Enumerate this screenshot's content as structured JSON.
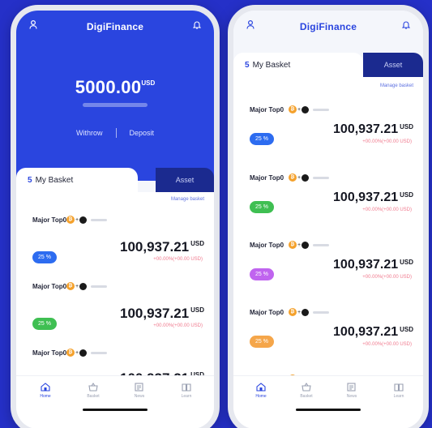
{
  "app": {
    "brand": "DigiFinance"
  },
  "balance": {
    "amount": "5000.00",
    "currency": "USD"
  },
  "hero_actions": {
    "withdraw": "Withrow",
    "deposit": "Deposit"
  },
  "tabs": {
    "basket_count": "5",
    "basket_label": "My Basket",
    "asset_label": "Asset"
  },
  "manage": {
    "phone1": "Manage basket",
    "phone2": "Manage basket"
  },
  "basket_items": [
    {
      "name": "Major Top0",
      "percent": "25 %",
      "price": "100,937.21",
      "currency": "USD",
      "change": "+00.00%(+00.00 USD)",
      "pill_color": "#2d6cf0"
    },
    {
      "name": "Major Top0",
      "percent": "25 %",
      "price": "100,937.21",
      "currency": "USD",
      "change": "+00.00%(+00.00 USD)",
      "pill_color": "#3fbf52"
    },
    {
      "name": "Major Top0",
      "percent": "25 %",
      "price": "100,937.21",
      "currency": "USD",
      "change": "+00.00%(+00.00 USD)",
      "pill_color": "#c064ef"
    },
    {
      "name": "Major Top0",
      "percent": "25 %",
      "price": "100,937.21",
      "currency": "USD",
      "change": "+00.00%(+00.00 USD)",
      "pill_color": "#f5a64a"
    },
    {
      "name": "Major Top0",
      "percent": "",
      "price": "",
      "currency": "",
      "change": "",
      "pill_color": "#c064ef"
    }
  ],
  "nav": {
    "phone1": [
      "Home",
      "Basket",
      "News",
      "Learn"
    ],
    "phone2": [
      "Home",
      "Basket",
      "News",
      "Learn"
    ]
  },
  "colors": {
    "brand_blue": "#2a45df",
    "asset_tab": "#1b2a8f",
    "change_red": "#f07a8e",
    "background": "#2530c8"
  }
}
